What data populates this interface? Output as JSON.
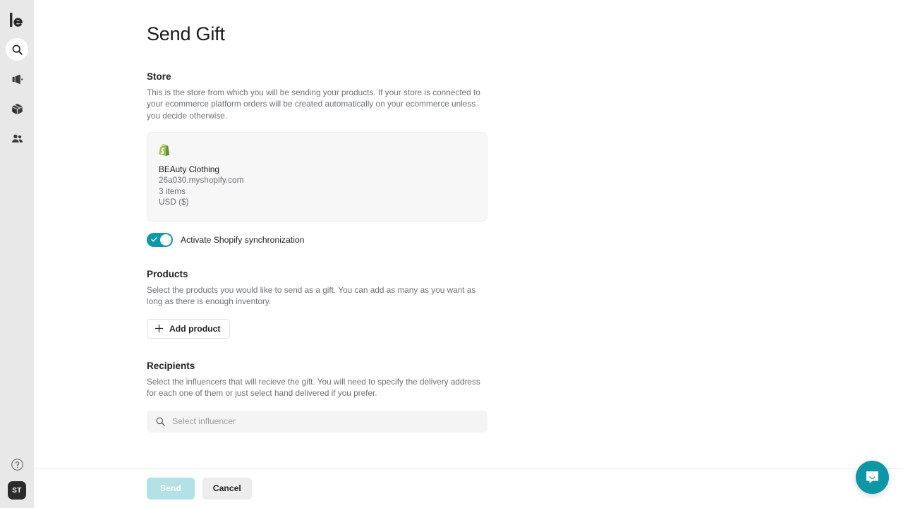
{
  "sidebar": {
    "logo_name": "lo-logo",
    "items": [
      {
        "name": "search",
        "icon": "search-icon",
        "active": true
      },
      {
        "name": "campaigns",
        "icon": "megaphone-icon",
        "active": false
      },
      {
        "name": "products",
        "icon": "box-icon",
        "active": false
      },
      {
        "name": "influencers",
        "icon": "people-icon",
        "active": false
      }
    ],
    "help_icon": "help-circle-icon",
    "avatar_initials": "ST"
  },
  "page": {
    "title": "Send Gift"
  },
  "store_section": {
    "title": "Store",
    "description": "This is the store from which you will be sending your products. If your store is connected to your ecommerce platform orders will be created automatically on your ecommerce unless you decide otherwise.",
    "card": {
      "platform_icon": "shopify-icon",
      "name": "BEAuty Clothing",
      "domain": "26a030.myshopify.com",
      "items": "3 items",
      "currency": "USD ($)"
    },
    "toggle": {
      "label": "Activate Shopify synchronization",
      "checked": true,
      "on_color": "#0e9aa7"
    }
  },
  "products_section": {
    "title": "Products",
    "description": "Select the products you would like to send as a gift. You can add as many as you want as long as there is enough inventory.",
    "add_button_label": "Add product",
    "add_button_icon": "plus-icon"
  },
  "recipients_section": {
    "title": "Recipients",
    "description": "Select the influencers that will recieve the gift. You will need to specify the delivery address for each one of them or just select hand delivered if you prefer.",
    "search": {
      "placeholder": "Select influencer",
      "value": "",
      "icon": "search-icon"
    }
  },
  "footer": {
    "send_label": "Send",
    "send_disabled": true,
    "cancel_label": "Cancel"
  },
  "chat": {
    "icon": "chat-bubble-icon",
    "color": "#0e95a6"
  }
}
